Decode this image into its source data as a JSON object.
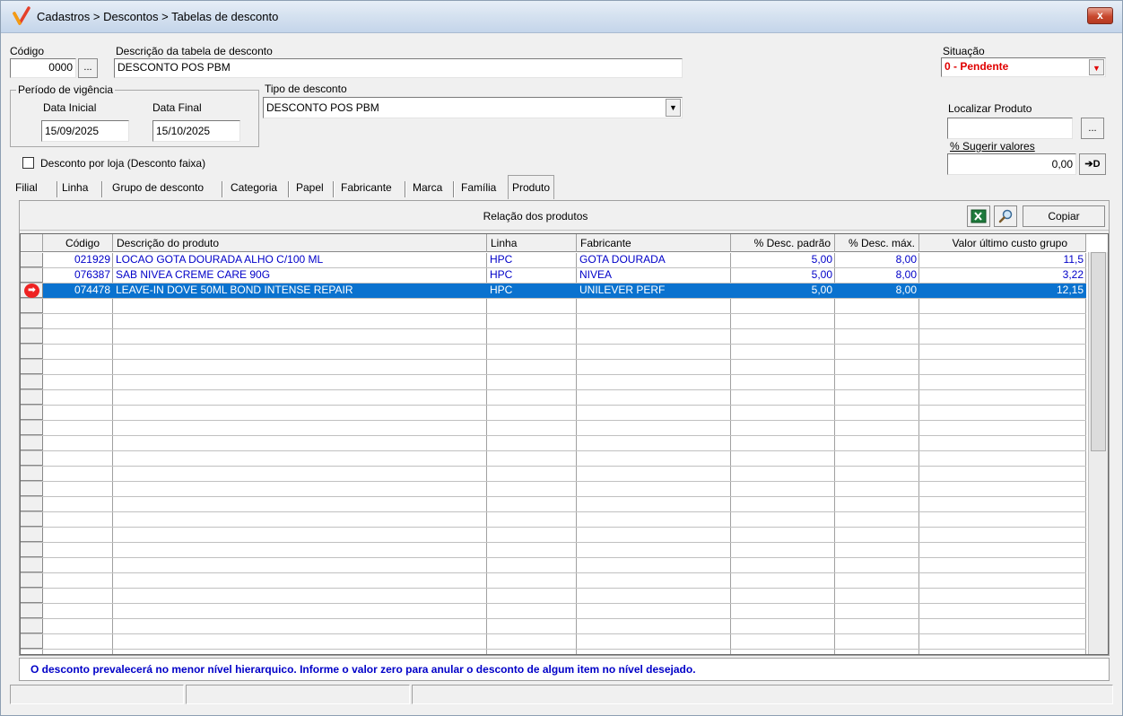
{
  "window": {
    "title": "Cadastros > Descontos > Tabelas de desconto",
    "close_label": "x"
  },
  "form": {
    "codigo_label": "Código",
    "codigo_value": "0000",
    "codigo_btn": "...",
    "descricao_label": "Descrição da tabela de desconto",
    "descricao_value": "DESCONTO POS PBM",
    "situacao_label": "Situação",
    "situacao_value": "0 - Pendente",
    "periodo_label": "Período de vigência",
    "data_inicial_label": "Data Inicial",
    "data_inicial_value": "15/09/2025",
    "data_final_label": "Data Final",
    "data_final_value": "15/10/2025",
    "tipo_label": "Tipo de desconto",
    "tipo_value": "DESCONTO POS PBM",
    "localizar_label": "Localizar Produto",
    "localizar_value": "",
    "localizar_btn": "...",
    "sugerir_label": "% Sugerir valores",
    "sugerir_value": "0,00",
    "apply_btn": "➔D",
    "checkbox_label": "Desconto por loja (Desconto faixa)",
    "checkbox_checked": false
  },
  "tabs": [
    "Filial",
    "Linha",
    "Grupo de desconto",
    "Categoria",
    "Papel",
    "Fabricante",
    "Marca",
    "Família",
    "Produto"
  ],
  "active_tab": "Produto",
  "panel": {
    "title": "Relação dos produtos",
    "copy_btn": "Copiar"
  },
  "grid": {
    "columns": [
      "Código",
      "Descrição do produto",
      "Linha",
      "Fabricante",
      "% Desc. padrão",
      "% Desc. máx.",
      "Valor último custo grupo"
    ],
    "rows": [
      {
        "codigo": "021929",
        "descricao": "LOCAO GOTA DOURADA ALHO C/100 ML",
        "linha": "HPC",
        "fabricante": "GOTA DOURADA",
        "desc_padrao": "5,00",
        "desc_max": "8,00",
        "valor": "11,5"
      },
      {
        "codigo": "076387",
        "descricao": "SAB NIVEA CREME CARE 90G",
        "linha": "HPC",
        "fabricante": "NIVEA",
        "desc_padrao": "5,00",
        "desc_max": "8,00",
        "valor": "3,22"
      },
      {
        "codigo": "074478",
        "descricao": "LEAVE-IN DOVE 50ML BOND INTENSE REPAIR",
        "linha": "HPC",
        "fabricante": "UNILEVER PERF",
        "desc_padrao": "5,00",
        "desc_max": "8,00",
        "valor": "12,15"
      }
    ],
    "selected_row": 2
  },
  "footer_message": "O desconto prevalecerá no menor nível hierarquico. Informe o valor zero para anular o desconto de algum item no nível desejado.",
  "colors": {
    "selection": "#0a72cf",
    "data_text": "#0000c8",
    "situacao_text": "#e00000"
  }
}
